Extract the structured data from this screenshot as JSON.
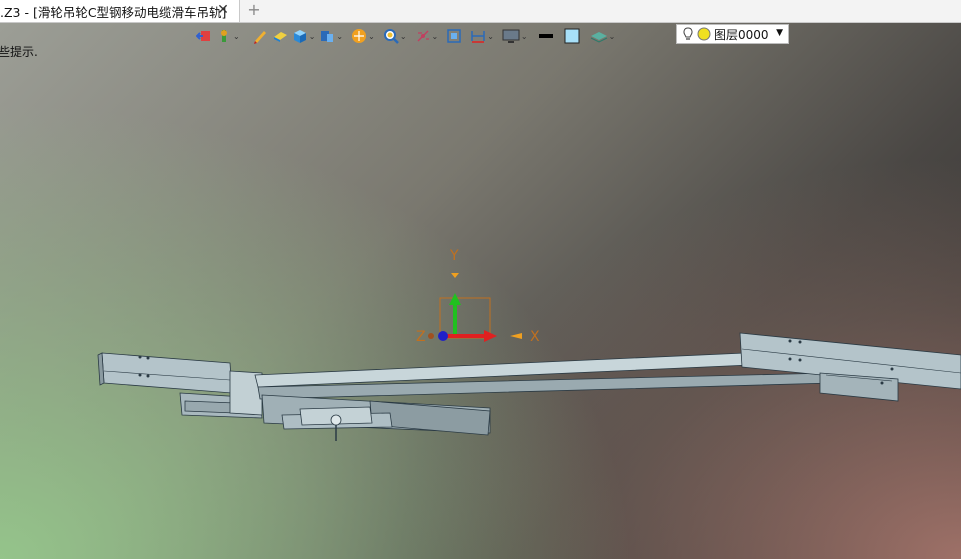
{
  "tab": {
    "title": ".Z3 - [滑轮吊轮C型钢移动电缆滑车吊轨]",
    "close": "✕",
    "new_tab": "+"
  },
  "viewport": {
    "prompt": "些提示."
  },
  "toolbar": {
    "icons": [
      "exit-icon",
      "plant-filter-icon",
      "pen-icon",
      "eraser-icon",
      "cube-icon",
      "view-cube-icon",
      "render-sphere-icon",
      "zoom-icon",
      "axis-icon",
      "fit-view-icon",
      "dimension-icon",
      "monitor-icon",
      "line-color-icon",
      "fill-color-icon",
      "layer-stack-icon"
    ],
    "layer": {
      "name": "图层0000",
      "arrow": "▼"
    }
  },
  "triad": {
    "x_label": "X",
    "y_label": "Y",
    "z_label": "Z",
    "colors": {
      "x": "#e02020",
      "y": "#20c020",
      "z": "#2020c8"
    }
  }
}
